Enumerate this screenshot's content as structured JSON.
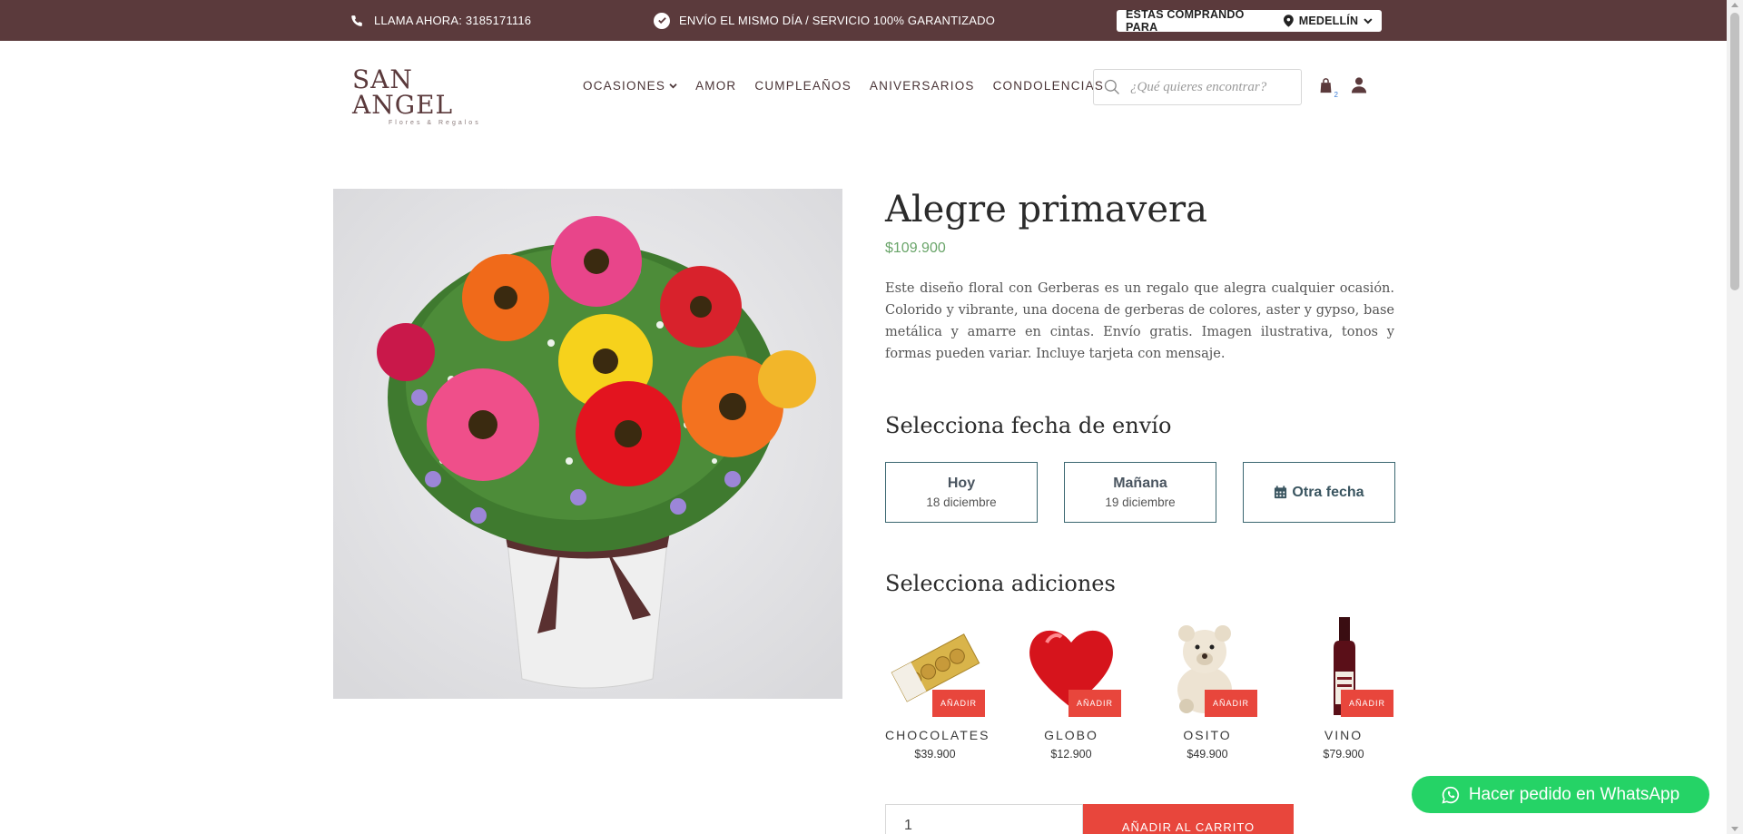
{
  "topbar": {
    "phone_label": "LLAMA AHORA: 3185171116",
    "promise_label": "ENVÍO EL MISMO DÍA / SERVICIO 100% GARANTIZADO",
    "buying_for_label": "ESTAS COMPRANDO PARA",
    "city": "MEDELLÍN",
    "background_color": "#5b3a3c"
  },
  "header": {
    "logo_text": "SAN ANGEL",
    "logo_subtext": "Flores & Regalos",
    "nav": [
      {
        "label": "OCASIONES",
        "has_dropdown": true
      },
      {
        "label": "AMOR"
      },
      {
        "label": "CUMPLEAÑOS"
      },
      {
        "label": "ANIVERSARIOS"
      },
      {
        "label": "CONDOLENCIAS"
      }
    ],
    "search_placeholder": "¿Qué quieres encontrar?",
    "cart_count": "2",
    "icons": [
      "phone-icon",
      "check-circle-icon",
      "map-pin-icon",
      "chevron-down-icon",
      "search-icon",
      "shopping-bag-icon",
      "user-icon",
      "calendar-icon",
      "whatsapp-icon"
    ]
  },
  "product": {
    "title": "Alegre primavera",
    "price": "$109.900",
    "description": "Este diseño floral con Gerberas es un regalo que alegra cualquier ocasión. Colorido y vibrante, una docena de gerberas de colores, aster y gypso, base metálica y amarre en cintas. Envío gratis. Imagen ilustrativa, tonos y formas pueden variar. Incluye tarjeta con mensaje.",
    "image_alt": "Arreglo floral de gerberas",
    "price_color": "#6aa56a"
  },
  "shipping": {
    "heading": "Selecciona fecha de envío",
    "options": [
      {
        "label": "Hoy",
        "date": "18 diciembre"
      },
      {
        "label": "Mañana",
        "date": "19 diciembre"
      },
      {
        "label": "Otra fecha"
      }
    ]
  },
  "addons": {
    "heading": "Selecciona adiciones",
    "add_label": "AÑADIR",
    "items": [
      {
        "name": "CHOCOLATES",
        "price": "$39.900"
      },
      {
        "name": "GLOBO",
        "price": "$12.900"
      },
      {
        "name": "OSITO",
        "price": "$49.900"
      },
      {
        "name": "VINO",
        "price": "$79.900"
      }
    ],
    "accent_color": "#e8463c"
  },
  "purchase": {
    "quantity": "1",
    "add_to_cart_label": "AÑADIR AL CARRITO"
  },
  "whatsapp": {
    "label": "Hacer pedido en WhatsApp",
    "color": "#25d366"
  }
}
